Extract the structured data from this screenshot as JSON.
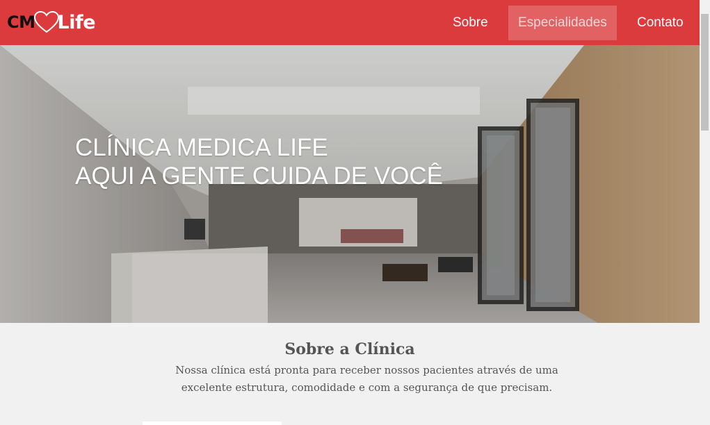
{
  "logo": {
    "cm": "CM",
    "life": "Life"
  },
  "nav": {
    "items": [
      "Sobre",
      "Especialidades",
      "Contato"
    ],
    "active": "Especialidades"
  },
  "hero": {
    "line1": "CLÍNICA MEDICA LIFE",
    "line2": "AQUI A GENTE CUIDA DE VOCÊ"
  },
  "about": {
    "title": "Sobre a Clínica",
    "text": "Nossa clínica está pronta para receber nossos pacientes através de uma excelente estrutura, comodidade e com a segurança de que precisam."
  },
  "colors": {
    "brand": "#dc3b3e",
    "active_tab": "#e26264",
    "text": "#555555"
  }
}
